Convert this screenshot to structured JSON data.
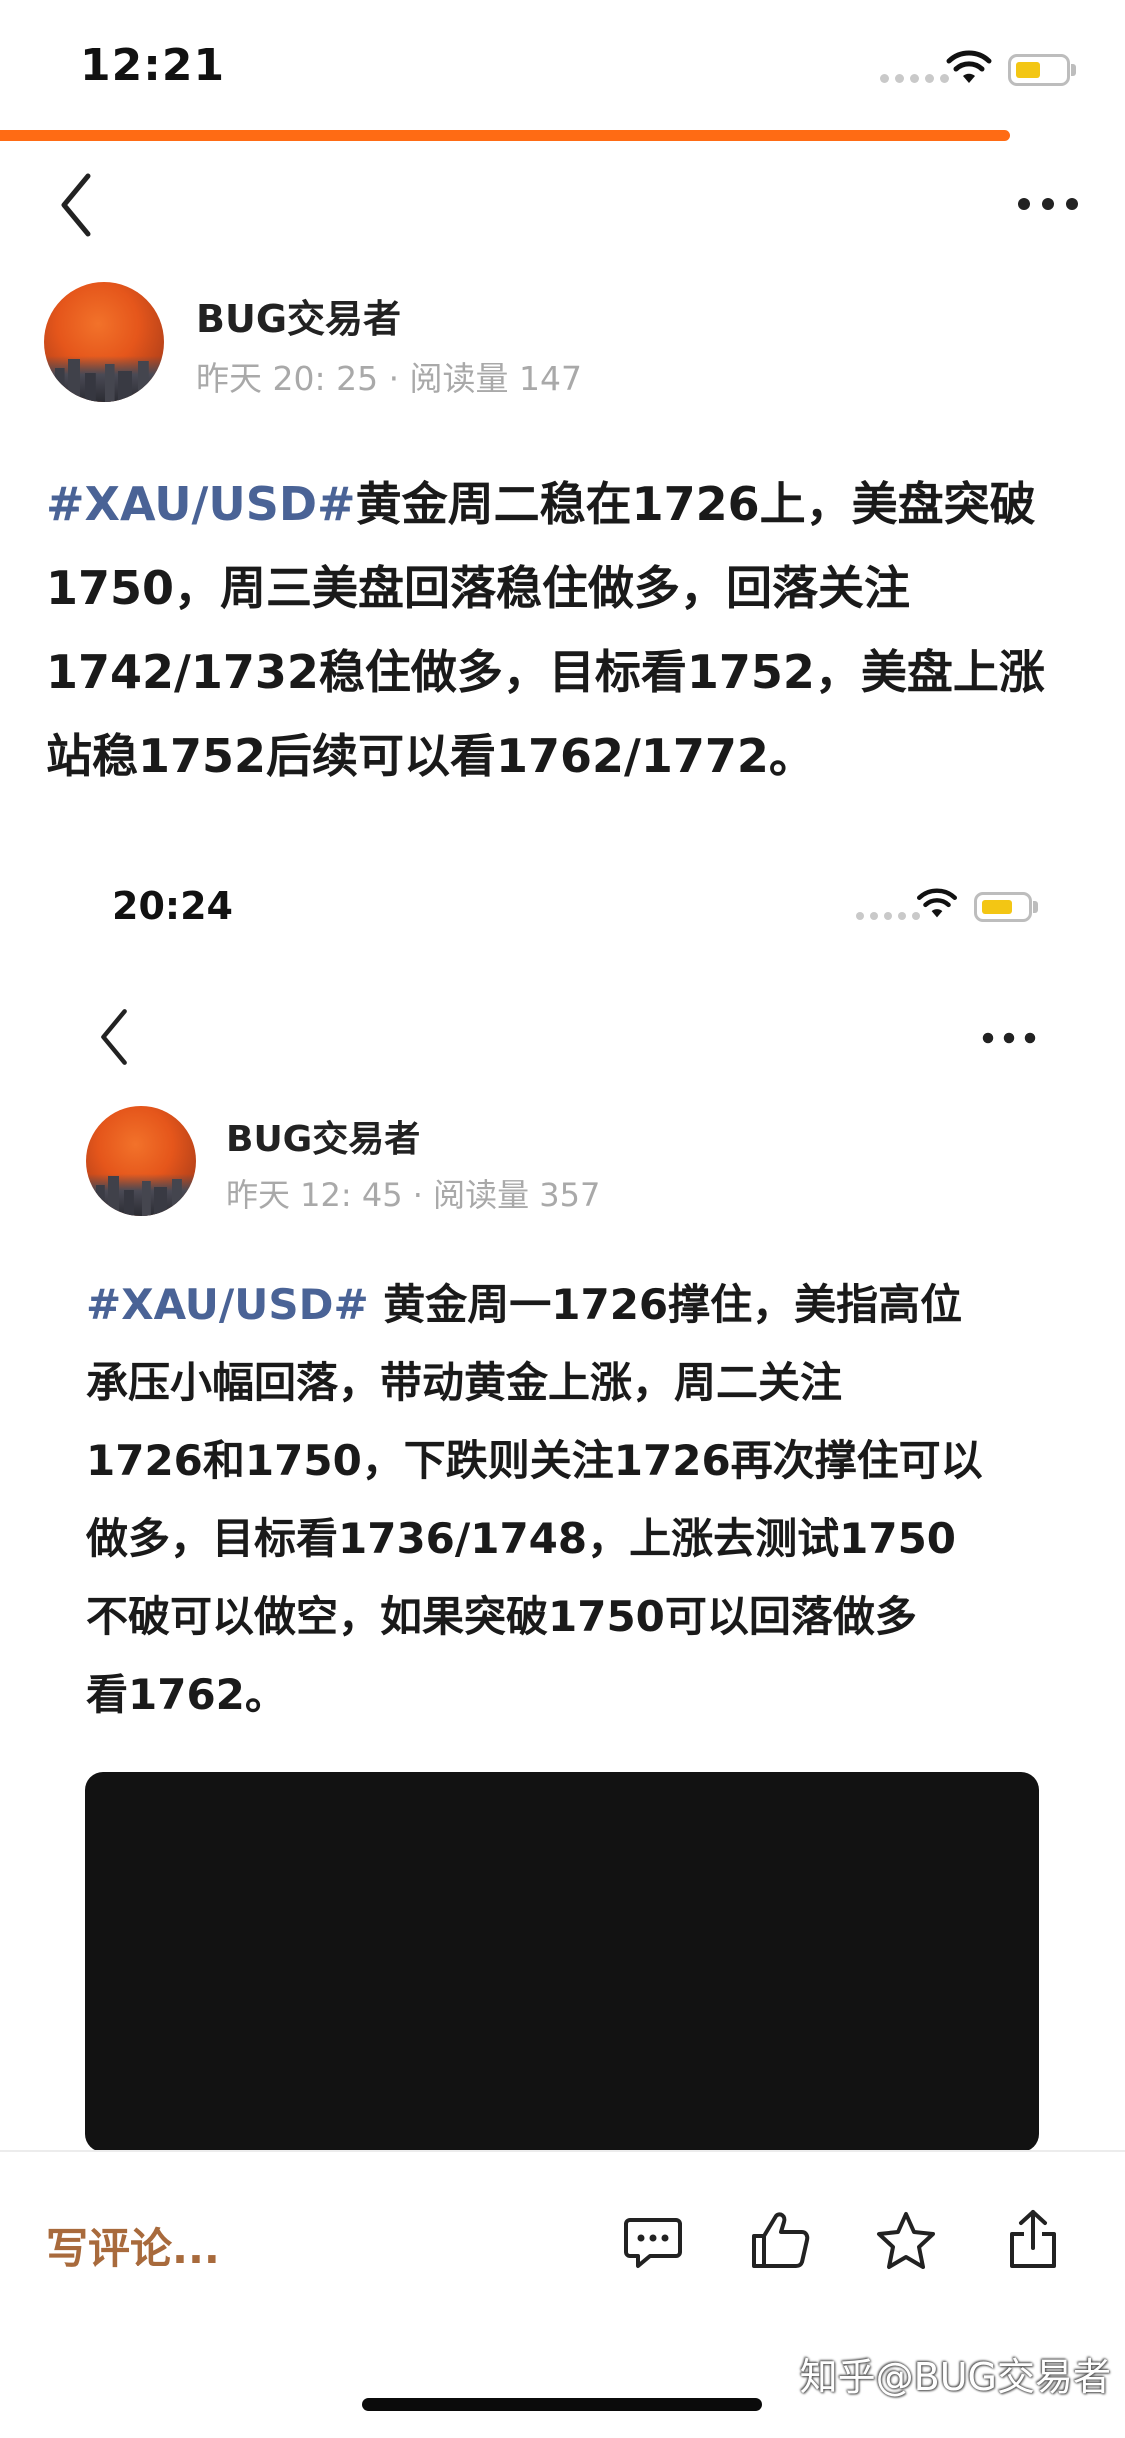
{
  "status_bar": {
    "time": "12:21"
  },
  "progress": {
    "value": 0.9
  },
  "author": {
    "name": "BUG交易者",
    "meta": "昨天 20: 25 · 阅读量 147"
  },
  "post": {
    "tag": "#XAU/USD#",
    "lines": [
      "黄金周二稳在1726上，美盘突破",
      "1750，周三美盘回落稳住做多，回落关注",
      "1742/1732稳住做多，目标看1752，美盘上涨",
      "站稳1752后续可以看1762/1772。"
    ]
  },
  "embedded_screenshot": {
    "status_time": "20:24",
    "author_name": "BUG交易者",
    "meta": "昨天 12: 45 · 阅读量 357",
    "tag": "#XAU/USD#",
    "lines": [
      " 黄金周一1726撑住，美指高位",
      "承压小幅回落，带动黄金上涨，周二关注",
      "1726和1750，下跌则关注1726再次撑住可以",
      "做多，目标看1736/1748，上涨去测试1750",
      "不破可以做空，如果突破1750可以回落做多",
      "看1762。"
    ]
  },
  "bottom_bar": {
    "comment_placeholder": "写评论...",
    "icons": [
      "comment-icon",
      "like-icon",
      "favorite-icon",
      "share-icon"
    ]
  },
  "watermark": "知乎@BUG交易者",
  "colors": {
    "accent": "#ff6b14",
    "tag": "#4a6396",
    "comment": "#a86a3c"
  }
}
